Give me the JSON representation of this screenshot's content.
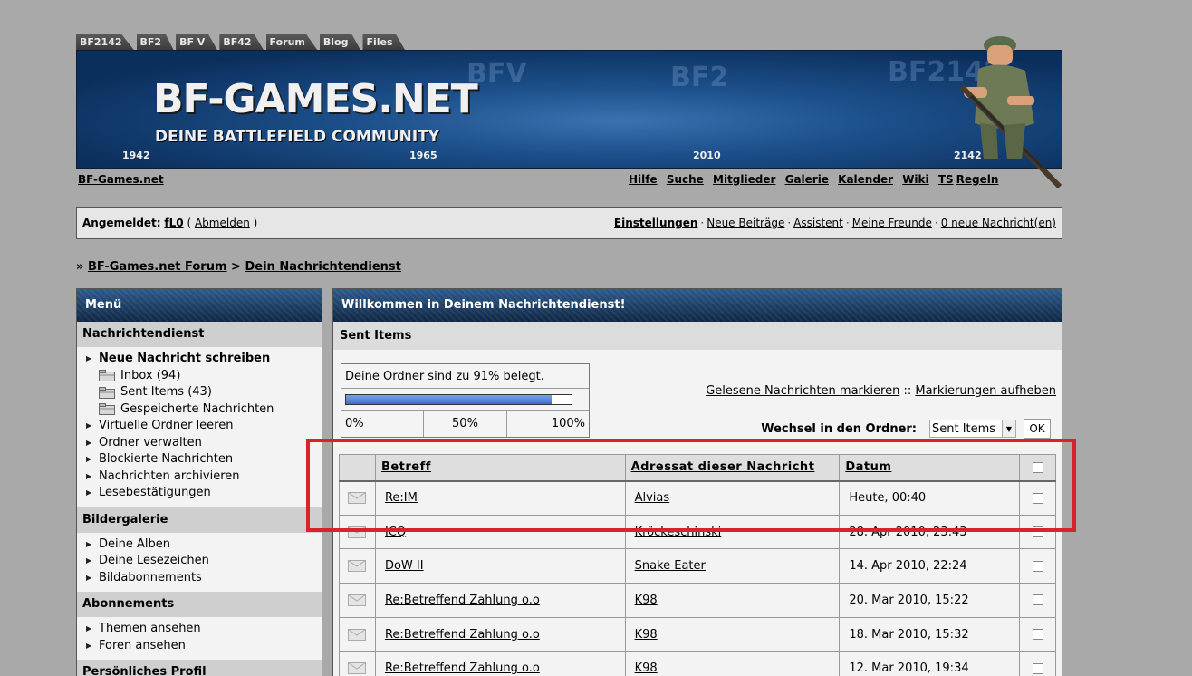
{
  "tabs": [
    "BF2142",
    "BF2",
    "BF V",
    "BF42",
    "Forum",
    "Blog",
    "Files"
  ],
  "banner": {
    "logo": "BF-GAMES.NET",
    "slogan": "DEINE BATTLEFIELD COMMUNITY",
    "years": [
      "1942",
      "1965",
      "2010",
      "2142"
    ],
    "bg_texts": [
      "BFV",
      "BF2",
      "BF2142"
    ]
  },
  "site_link": "BF-Games.net",
  "top_nav": [
    "Hilfe",
    "Suche",
    "Mitglieder",
    "Galerie",
    "Kalender",
    "Wiki",
    "TS",
    "Regeln"
  ],
  "login": {
    "prefix": "Angemeldet:",
    "user": "fL0",
    "logout": "Abmelden",
    "links": [
      "Einstellungen",
      "Neue Beiträge",
      "Assistent",
      "Meine Freunde",
      "0 neue Nachricht(en)"
    ]
  },
  "breadcrumb": {
    "marker": "»",
    "forum": "BF-Games.net Forum",
    "sep": ">",
    "current": "Dein Nachrichtendienst"
  },
  "sidebar": {
    "title": "Menü",
    "sections": [
      {
        "title": "Nachrichtendienst",
        "items": [
          {
            "label": "Neue Nachricht schreiben",
            "type": "bold"
          },
          {
            "label": "Inbox (94)",
            "type": "folder"
          },
          {
            "label": "Sent Items (43)",
            "type": "folder"
          },
          {
            "label": "Gespeicherte Nachrichten",
            "type": "folder"
          },
          {
            "label": "Virtuelle Ordner leeren",
            "type": "link"
          },
          {
            "label": "Ordner verwalten",
            "type": "link"
          },
          {
            "label": "Blockierte Nachrichten",
            "type": "link"
          },
          {
            "label": "Nachrichten archivieren",
            "type": "link"
          },
          {
            "label": "Lesebestätigungen",
            "type": "link"
          }
        ]
      },
      {
        "title": "Bildergalerie",
        "items": [
          {
            "label": "Deine Alben",
            "type": "link"
          },
          {
            "label": "Deine Lesezeichen",
            "type": "link"
          },
          {
            "label": "Bildabonnements",
            "type": "link"
          }
        ]
      },
      {
        "title": "Abonnements",
        "items": [
          {
            "label": "Themen ansehen",
            "type": "link"
          },
          {
            "label": "Foren ansehen",
            "type": "link"
          }
        ]
      },
      {
        "title": "Persönliches Profil",
        "items": []
      }
    ]
  },
  "main": {
    "title": "Willkommen in Deinem Nachrichtendienst!",
    "subtitle": "Sent Items",
    "quota_text": "Deine Ordner sind zu 91% belegt.",
    "quota_fraction": 0.91,
    "quota_scale": [
      "0%",
      "50%",
      "100%"
    ],
    "mark_read": "Gelesene Nachrichten markieren",
    "mark_sep": "::",
    "unmark": "Markierungen aufheben",
    "switch_label": "Wechsel in den Ordner:",
    "switch_selected": "Sent Items",
    "ok_label": "OK",
    "columns": [
      "Betreff",
      "Adressat dieser Nachricht",
      "Datum"
    ],
    "messages": [
      {
        "subject": "Re:IM",
        "recipient": "Alvias",
        "date": "Heute, 00:40"
      },
      {
        "subject": "ICQ",
        "recipient": "Kröckeschinski",
        "date": "28. Apr 2010, 23:43"
      },
      {
        "subject": "DoW II",
        "recipient": "Snake Eater",
        "date": "14. Apr 2010, 22:24"
      },
      {
        "subject": "Re:Betreffend Zahlung o.o",
        "recipient": "K98",
        "date": "20. Mar 2010, 15:22"
      },
      {
        "subject": "Re:Betreffend Zahlung o.o",
        "recipient": "K98",
        "date": "18. Mar 2010, 15:32"
      },
      {
        "subject": "Re:Betreffend Zahlung o.o",
        "recipient": "K98",
        "date": "12. Mar 2010, 19:34"
      }
    ]
  },
  "colors": {
    "highlight": "#d9232a",
    "header_blue": "#1f4a7a",
    "background": "#a9a9a9"
  }
}
